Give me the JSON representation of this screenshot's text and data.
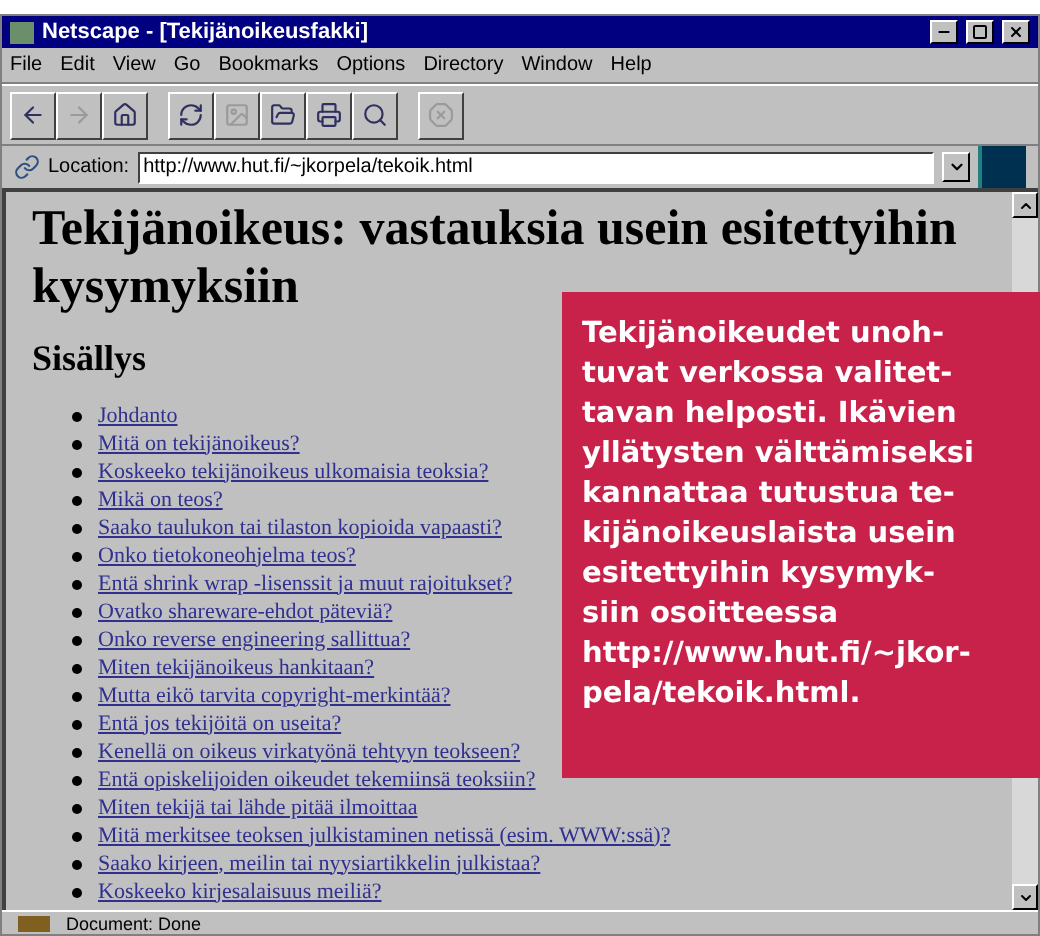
{
  "window": {
    "title": "Netscape - [Tekijänoikeusfakki]"
  },
  "menu": [
    "File",
    "Edit",
    "View",
    "Go",
    "Bookmarks",
    "Options",
    "Directory",
    "Window",
    "Help"
  ],
  "toolbar": [
    [
      {
        "kind": "back",
        "disabled": false
      },
      {
        "kind": "forward",
        "disabled": true
      },
      {
        "kind": "home",
        "disabled": false
      }
    ],
    [
      {
        "kind": "reload",
        "disabled": false
      },
      {
        "kind": "images",
        "disabled": true
      },
      {
        "kind": "open",
        "disabled": false
      },
      {
        "kind": "print",
        "disabled": false
      },
      {
        "kind": "find",
        "disabled": false
      }
    ],
    [
      {
        "kind": "stop",
        "disabled": true
      }
    ]
  ],
  "location": {
    "label": "Location:",
    "value": "http://www.hut.fi/~jkorpela/tekoik.html"
  },
  "page": {
    "heading": "Tekijänoikeus: vastauksia usein esitettyihin kysymyksiin",
    "subheading": "Sisällys",
    "links": [
      "Johdanto",
      "Mitä on tekijänoikeus?",
      "Koskeeko tekijänoikeus ulkomaisia teoksia?",
      "Mikä on teos?",
      "Saako taulukon tai tilaston kopioida vapaasti?",
      "Onko tietokoneohjelma teos?",
      "Entä shrink wrap -lisenssit ja muut rajoitukset?",
      "Ovatko shareware-ehdot päteviä?",
      "Onko reverse engineering sallittua?",
      "Miten tekijänoikeus hankitaan?",
      "Mutta eikö tarvita copyright-merkintää?",
      "Entä jos tekijöitä on useita?",
      "Kenellä on oikeus virkatyönä tehtyyn teokseen?",
      "Entä opiskelijoiden oikeudet tekemiinsä teoksiin?",
      "Miten tekijä tai lähde pitää ilmoittaa",
      "Mitä merkitsee teoksen julkistaminen netissä (esim. WWW:ssä)?",
      "Saako kirjeen, meilin tai nyysiartikkelin julkistaa?",
      "Koskeeko kirjesalaisuus meiliä?"
    ]
  },
  "status_bar": {
    "text": "Document: Done"
  },
  "caption": "Tekijänoikeudet unoh-\ntuvat verkossa valitet-\ntavan helposti. Ikävien\nyllätysten välttämiseksi\nkannattaa tutustua te-\nkijänoikeuslaista usein\nesitettyihin kysymyk-\nsiin osoitteessa\nhttp://www.hut.fi/~jkor-\npela/tekoik.html."
}
